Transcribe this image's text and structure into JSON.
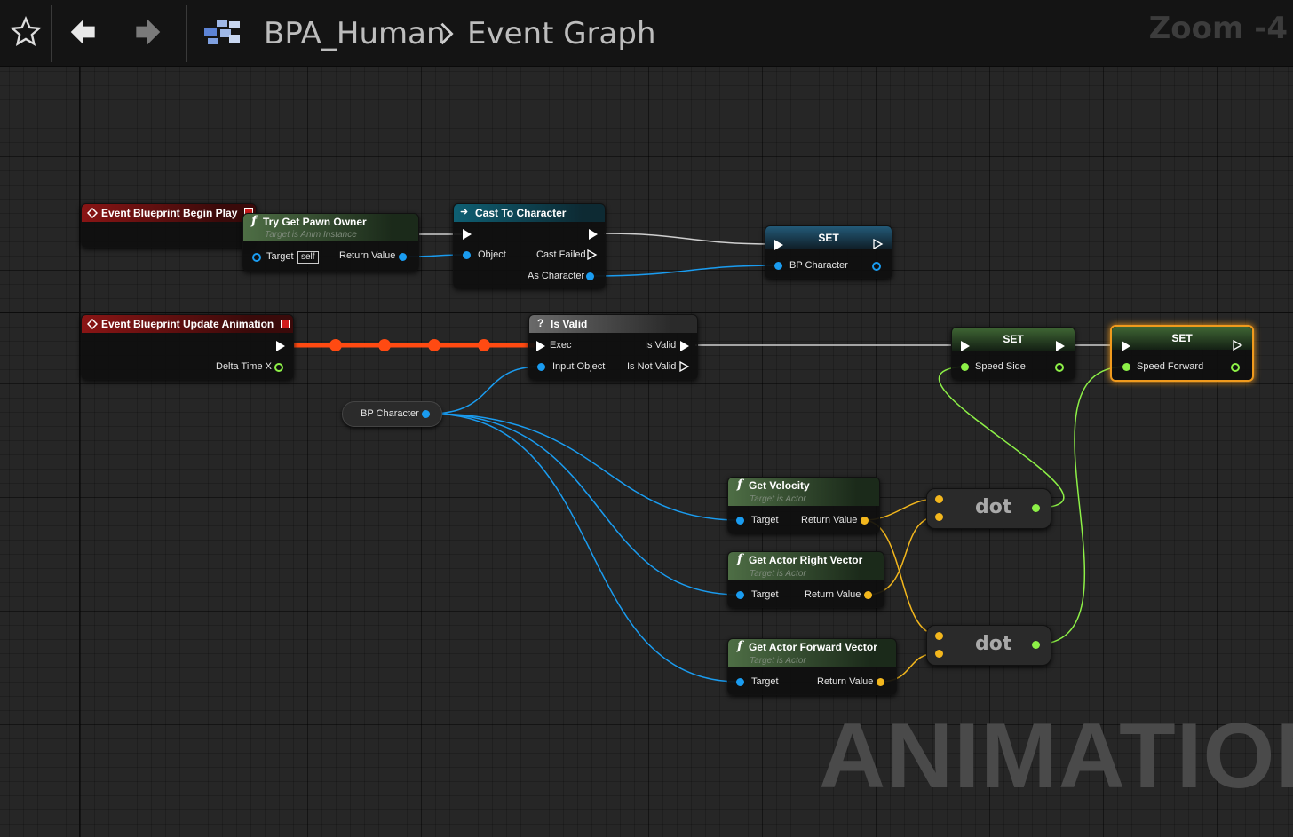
{
  "breadcrumb": {
    "asset": "BPA_Human",
    "graph": "Event Graph"
  },
  "zoom": "Zoom -4",
  "watermark": "ANIMATION",
  "colors": {
    "exec": "#ffffff",
    "object": "#1a9cf0",
    "vector": "#f3b71d",
    "float": "#8df047",
    "selected": "#f09a1d",
    "highlight_wire": "#ff4a12"
  },
  "icons": {
    "favorite": "star-icon",
    "back": "arrow-left-icon",
    "forward": "arrow-right-icon",
    "blueprint": "blueprint-icon",
    "separator": "chevron-right-icon"
  },
  "nodes": {
    "begin_play": {
      "title": "Event Blueprint Begin Play"
    },
    "try_get_pawn": {
      "title": "Try Get Pawn Owner",
      "subtitle": "Target is Anim Instance",
      "target": "Target",
      "self": "self",
      "return": "Return Value"
    },
    "cast": {
      "title": "Cast To Character",
      "object": "Object",
      "cast_failed": "Cast Failed",
      "as_character": "As Character"
    },
    "set_bp": {
      "title": "SET",
      "var": "BP Character"
    },
    "update_anim": {
      "title": "Event Blueprint Update Animation",
      "delta": "Delta Time X"
    },
    "is_valid": {
      "title": "Is Valid",
      "exec": "Exec",
      "input": "Input Object",
      "valid": "Is Valid",
      "not_valid": "Is Not Valid"
    },
    "bp_character_var": {
      "label": "BP Character"
    },
    "set_side": {
      "title": "SET",
      "var": "Speed Side"
    },
    "set_forward": {
      "title": "SET",
      "var": "Speed Forward"
    },
    "get_velocity": {
      "title": "Get Velocity",
      "subtitle": "Target is Actor",
      "target": "Target",
      "return": "Return Value"
    },
    "get_right": {
      "title": "Get Actor Right Vector",
      "subtitle": "Target is Actor",
      "target": "Target",
      "return": "Return Value"
    },
    "get_forward": {
      "title": "Get Actor Forward Vector",
      "subtitle": "Target is Actor",
      "target": "Target",
      "return": "Return Value"
    },
    "dot1": {
      "label": "dot"
    },
    "dot2": {
      "label": "dot"
    }
  }
}
